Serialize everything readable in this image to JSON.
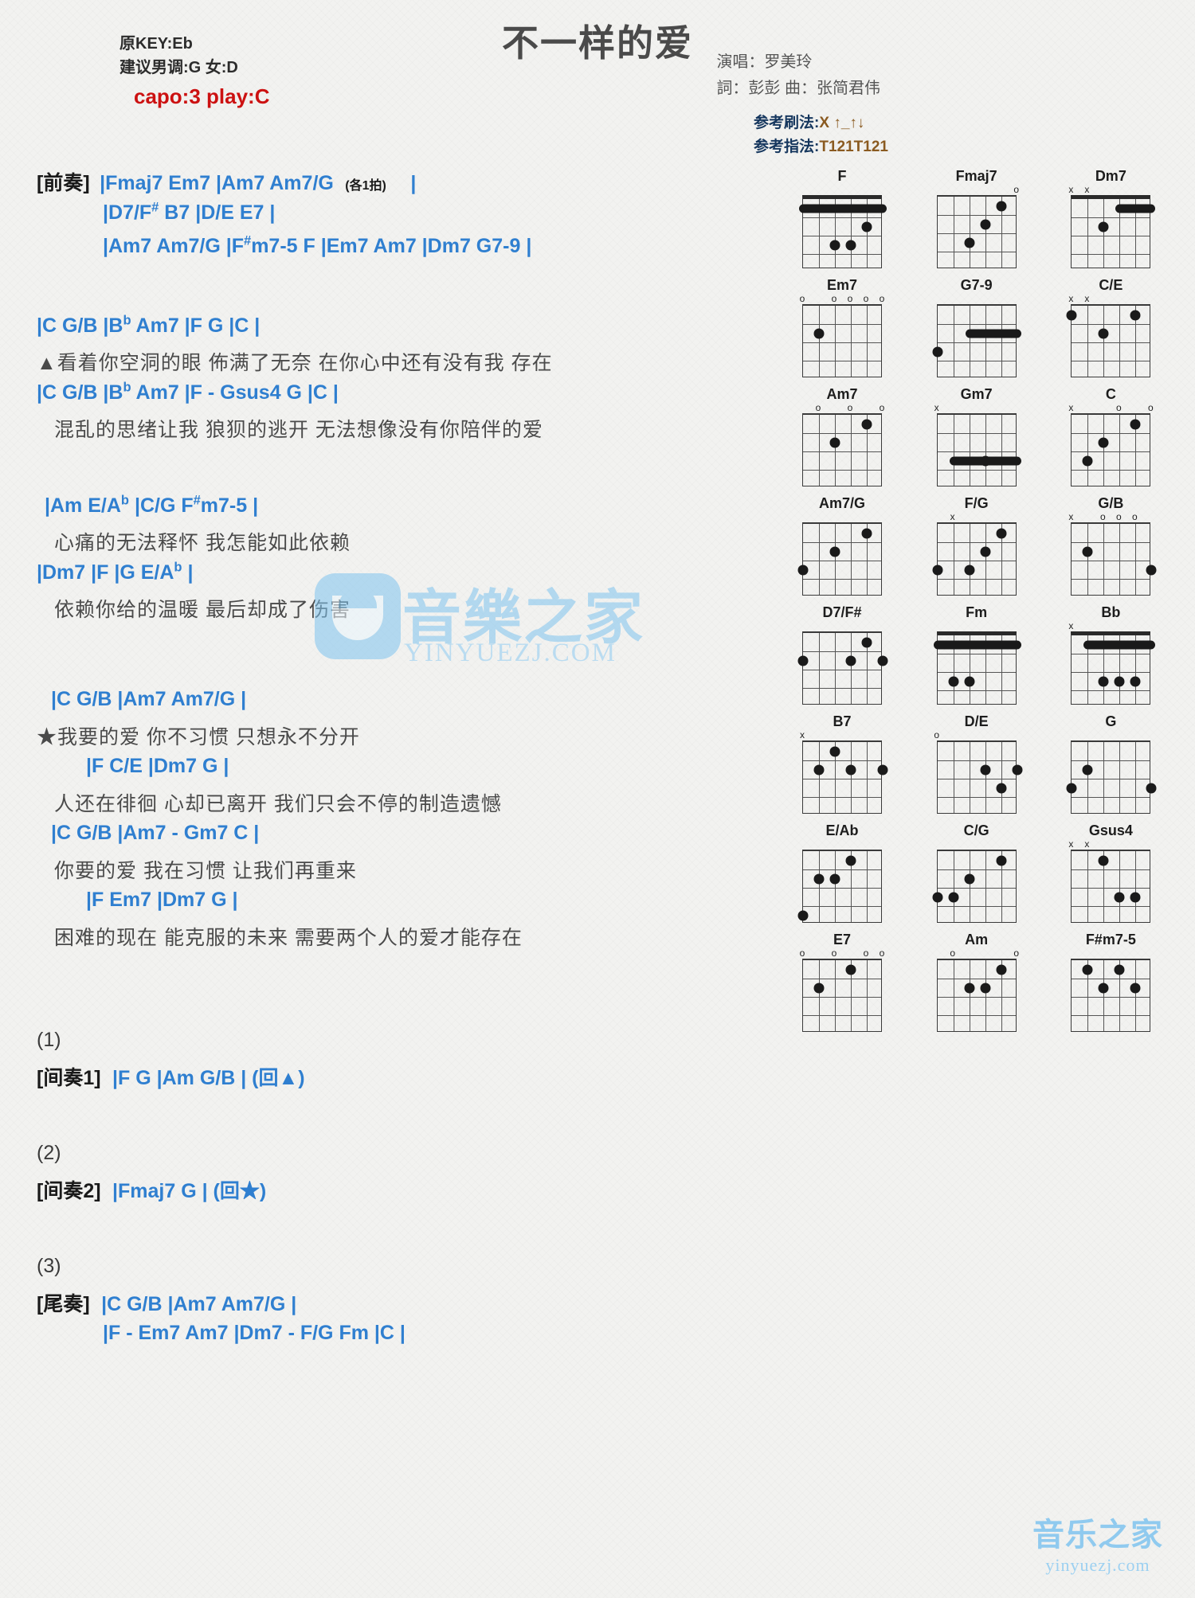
{
  "header": {
    "title": "不一样的爱",
    "orig_key": "原KEY:Eb",
    "suggest_key": "建议男调:G 女:D",
    "capo": "capo:3 play:C",
    "singer": "演唱：罗美玲",
    "writers": "詞：彭彭   曲：张简君伟",
    "strum_label": "参考刷法:",
    "strum_value": "X ↑_↑↓",
    "finger_label": "参考指法:",
    "finger_value": "T121T121"
  },
  "sections": {
    "intro_tag": "[前奏]",
    "intro_l1": "|Fmaj7   Em7    |Am7   Am7/G",
    "intro_l1_note": "(各1拍)",
    "intro_l1_end": "|",
    "intro_l2_a": "|D7/F",
    "intro_l2_sharp": "#",
    "intro_l2_b": "   B7   |D/E    E7    |",
    "intro_l3_a": "|Am7   Am7/G   |F",
    "intro_l3_sharp": "#",
    "intro_l3_b": "m7-5    F   |Em7    Am7   |Dm7    G7-9    |",
    "v1_c1_a": "|C        G/B        |B",
    "v1_c1_flat": "b",
    "v1_c1_b": "        Am7     |F         G      |C    |",
    "v1_lyric1": "▲看着你空洞的眼   佈满了无奈   在你心中还有没有我   存在",
    "v1_c2_a": "|C        G/B        |B",
    "v1_c2_flat": "b",
    "v1_c2_b": "        Am7     |F    -   Gsus4    G    |C    |",
    "v1_lyric2": "混乱的思绪让我   狼狈的逃开   无法想像没有你陪伴的爱",
    "pre_c1_a": "|Am       E/A",
    "pre_c1_flat": "b",
    "pre_c1_b": "     |C/G      F",
    "pre_c1_sharp": "#",
    "pre_c1_c": "m7-5    |",
    "pre_lyric1": "心痛的无法释怀   我怎能如此依赖",
    "pre_c2_a": "|Dm7                    |F                       |G    E/A",
    "pre_c2_flat": "b",
    "pre_c2_b": "     |",
    "pre_lyric2": "依赖你给的温暖   最后却成了伤害",
    "ch_c1": "|C            G/B          |Am7      Am7/G      |",
    "ch_lyric1": "★我要的爱   你不习惯   只想永不分开",
    "ch_c2": "|F              C/E               |Dm7    G    |",
    "ch_lyric2": "人还在徘徊   心却已离开   我们只会不停的制造遗憾",
    "ch_c3": "|C          G/B          |Am7  -  Gm7    C    |",
    "ch_lyric3": "你要的爱   我在习惯   让我们再重来",
    "ch_c4": "|F              Em7              |Dm7       G      |",
    "ch_lyric4": "困难的现在   能克服的未来   需要两个人的爱才能存在",
    "n1": "(1)",
    "inter1_tag": "[间奏1]",
    "inter1_chords": "|F    G    |Am    G/B    |   (回▲)",
    "n2": "(2)",
    "inter2_tag": "[间奏2]",
    "inter2_chords": "|Fmaj7    G    |   (回★)",
    "n3": "(3)",
    "outro_tag": "[尾奏]",
    "outro_l1": "|C    G/B   |Am7     Am7/G    |",
    "outro_l2": "|F  -  Em7    Am7  |Dm7   -   F/G    Fm    |C    |"
  },
  "diagrams": [
    {
      "name": "F",
      "marks": [
        {
          "s": 6,
          "t": ""
        },
        {
          "s": 5,
          "t": ""
        }
      ],
      "barre": {
        "fret": 1,
        "from": 6,
        "to": 1
      },
      "dots": [
        {
          "s": 4,
          "f": 3
        },
        {
          "s": 3,
          "f": 3
        },
        {
          "s": 2,
          "f": 2
        }
      ],
      "open": []
    },
    {
      "name": "Fmaj7",
      "marks": [],
      "barre": null,
      "dots": [
        {
          "s": 4,
          "f": 3
        },
        {
          "s": 3,
          "f": 2
        },
        {
          "s": 2,
          "f": 1
        }
      ],
      "open": [
        1
      ]
    },
    {
      "name": "Dm7",
      "marks": [
        {
          "s": 6,
          "t": "x"
        },
        {
          "s": 5,
          "t": "x"
        }
      ],
      "barre": {
        "fret": 1,
        "from": 3,
        "to": 1
      },
      "dots": [
        {
          "s": 4,
          "f": 2
        }
      ],
      "open": []
    },
    {
      "name": "Em7",
      "marks": [],
      "barre": null,
      "dots": [
        {
          "s": 5,
          "f": 2
        }
      ],
      "open": [
        6,
        4,
        3,
        2,
        1
      ]
    },
    {
      "name": "G7-9",
      "marks": [],
      "barre": {
        "fret": 2,
        "from": 4,
        "to": 1
      },
      "dots": [
        {
          "s": 6,
          "f": 3
        }
      ],
      "open": []
    },
    {
      "name": "C/E",
      "marks": [
        {
          "s": 6,
          "t": "x"
        },
        {
          "s": 5,
          "t": "x"
        }
      ],
      "barre": null,
      "dots": [
        {
          "s": 6,
          "f": 1
        },
        {
          "s": 4,
          "f": 2
        },
        {
          "s": 2,
          "f": 1
        }
      ],
      "open": []
    },
    {
      "name": "Am7",
      "marks": [],
      "barre": null,
      "dots": [
        {
          "s": 4,
          "f": 2
        },
        {
          "s": 2,
          "f": 1
        }
      ],
      "open": [
        5,
        3,
        1
      ]
    },
    {
      "name": "Gm7",
      "marks": [
        {
          "s": 6,
          "t": "x"
        }
      ],
      "barre": {
        "fret": 3,
        "from": 5,
        "to": 1
      },
      "dots": [
        {
          "s": 3,
          "f": 3
        }
      ],
      "open": []
    },
    {
      "name": "C",
      "marks": [
        {
          "s": 6,
          "t": "x"
        }
      ],
      "barre": null,
      "dots": [
        {
          "s": 5,
          "f": 3
        },
        {
          "s": 4,
          "f": 2
        },
        {
          "s": 2,
          "f": 1
        }
      ],
      "open": [
        3,
        1
      ]
    },
    {
      "name": "Am7/G",
      "marks": [],
      "barre": null,
      "dots": [
        {
          "s": 6,
          "f": 3
        },
        {
          "s": 4,
          "f": 2
        },
        {
          "s": 2,
          "f": 1
        }
      ],
      "open": []
    },
    {
      "name": "F/G",
      "marks": [
        {
          "s": 5,
          "t": "x"
        }
      ],
      "barre": null,
      "dots": [
        {
          "s": 6,
          "f": 3
        },
        {
          "s": 4,
          "f": 3
        },
        {
          "s": 3,
          "f": 2
        },
        {
          "s": 2,
          "f": 1
        }
      ],
      "open": []
    },
    {
      "name": "G/B",
      "marks": [
        {
          "s": 6,
          "t": "x"
        }
      ],
      "barre": null,
      "dots": [
        {
          "s": 5,
          "f": 2
        },
        {
          "s": 1,
          "f": 3
        }
      ],
      "open": [
        4,
        3,
        2
      ]
    },
    {
      "name": "D7/F#",
      "marks": [],
      "barre": null,
      "dots": [
        {
          "s": 6,
          "f": 2
        },
        {
          "s": 3,
          "f": 2
        },
        {
          "s": 2,
          "f": 1
        },
        {
          "s": 1,
          "f": 2
        }
      ],
      "open": []
    },
    {
      "name": "Fm",
      "marks": [],
      "barre": {
        "fret": 1,
        "from": 6,
        "to": 1
      },
      "dots": [
        {
          "s": 5,
          "f": 3
        },
        {
          "s": 4,
          "f": 3
        }
      ],
      "open": []
    },
    {
      "name": "Bb",
      "marks": [
        {
          "s": 6,
          "t": "x"
        }
      ],
      "barre": {
        "fret": 1,
        "from": 5,
        "to": 1
      },
      "dots": [
        {
          "s": 4,
          "f": 3
        },
        {
          "s": 3,
          "f": 3
        },
        {
          "s": 2,
          "f": 3
        }
      ],
      "open": []
    },
    {
      "name": "B7",
      "marks": [
        {
          "s": 6,
          "t": "x"
        }
      ],
      "barre": null,
      "dots": [
        {
          "s": 5,
          "f": 2
        },
        {
          "s": 4,
          "f": 1
        },
        {
          "s": 3,
          "f": 2
        },
        {
          "s": 1,
          "f": 2
        }
      ],
      "open": []
    },
    {
      "name": "D/E",
      "marks": [],
      "barre": null,
      "dots": [
        {
          "s": 3,
          "f": 2
        },
        {
          "s": 2,
          "f": 3
        },
        {
          "s": 1,
          "f": 2
        }
      ],
      "open": [
        6
      ]
    },
    {
      "name": "G",
      "marks": [],
      "barre": null,
      "dots": [
        {
          "s": 6,
          "f": 3
        },
        {
          "s": 5,
          "f": 2
        },
        {
          "s": 1,
          "f": 3
        }
      ],
      "open": []
    },
    {
      "name": "E/Ab",
      "marks": [],
      "barre": null,
      "dots": [
        {
          "s": 6,
          "f": 4
        },
        {
          "s": 5,
          "f": 2
        },
        {
          "s": 4,
          "f": 2
        },
        {
          "s": 3,
          "f": 1
        }
      ],
      "open": []
    },
    {
      "name": "C/G",
      "marks": [],
      "barre": null,
      "dots": [
        {
          "s": 6,
          "f": 3
        },
        {
          "s": 5,
          "f": 3
        },
        {
          "s": 4,
          "f": 2
        },
        {
          "s": 2,
          "f": 1
        }
      ],
      "open": []
    },
    {
      "name": "Gsus4",
      "marks": [
        {
          "s": 6,
          "t": "x"
        },
        {
          "s": 5,
          "t": "x"
        }
      ],
      "barre": null,
      "dots": [
        {
          "s": 4,
          "f": 1
        },
        {
          "s": 3,
          "f": 3
        },
        {
          "s": 2,
          "f": 3
        }
      ],
      "open": []
    },
    {
      "name": "E7",
      "marks": [],
      "barre": null,
      "dots": [
        {
          "s": 5,
          "f": 2
        },
        {
          "s": 3,
          "f": 1
        }
      ],
      "open": [
        6,
        4,
        2,
        1
      ]
    },
    {
      "name": "Am",
      "marks": [],
      "barre": null,
      "dots": [
        {
          "s": 4,
          "f": 2
        },
        {
          "s": 3,
          "f": 2
        },
        {
          "s": 2,
          "f": 1
        }
      ],
      "open": [
        5,
        1
      ]
    },
    {
      "name": "F#m7-5",
      "marks": [],
      "barre": null,
      "dots": [
        {
          "s": 5,
          "f": 1
        },
        {
          "s": 4,
          "f": 2
        },
        {
          "s": 3,
          "f": 1
        },
        {
          "s": 2,
          "f": 2
        }
      ],
      "open": []
    }
  ],
  "watermark": {
    "center_cn": "音樂之家",
    "center_url": "YINYUEZJ.COM",
    "bottom_cn": "音乐之家",
    "bottom_url": "yinyuezj.com"
  }
}
